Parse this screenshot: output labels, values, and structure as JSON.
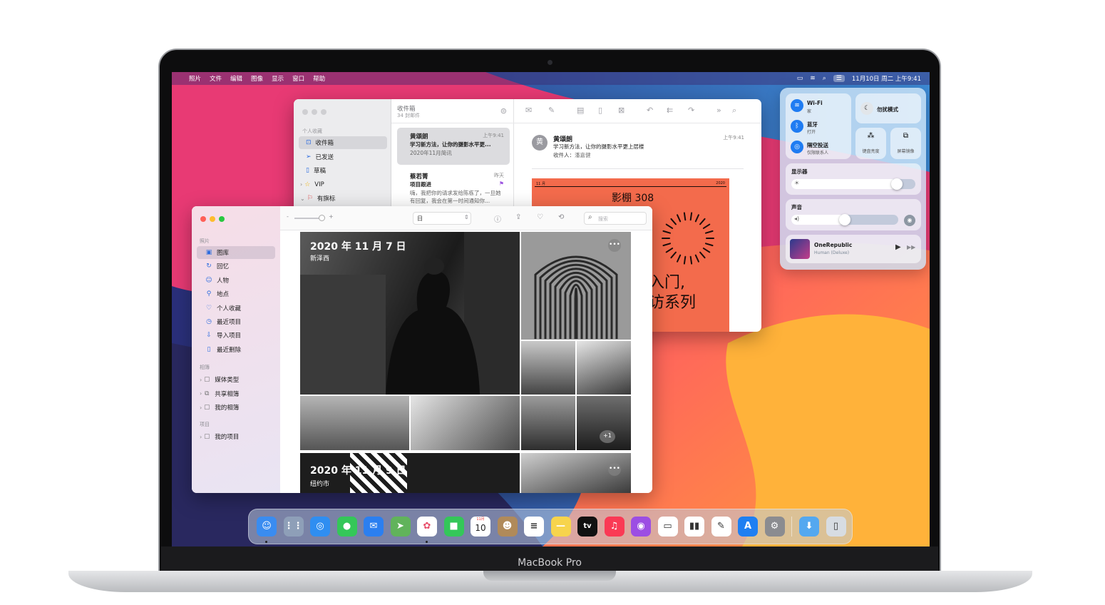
{
  "device": {
    "label": "MacBook Pro"
  },
  "menubar": {
    "apple": "",
    "items": [
      "照片",
      "文件",
      "编辑",
      "图像",
      "显示",
      "窗口",
      "帮助"
    ],
    "clock": "11月10日 周二 上午9:41"
  },
  "mail": {
    "sidebar": {
      "section": "个人收藏",
      "items": [
        {
          "label": "收件箱",
          "icon": "inbox-icon"
        },
        {
          "label": "已发送",
          "icon": "paperplane-icon"
        },
        {
          "label": "草稿",
          "icon": "document-icon"
        },
        {
          "label": "VIP",
          "icon": "star-icon"
        },
        {
          "label": "有旗标",
          "icon": "flag-icon"
        }
      ]
    },
    "list": {
      "title": "收件箱",
      "count": "34 封邮件",
      "messages": [
        {
          "sender": "黄頌朗",
          "time": "上午9:41",
          "subject": "学习新方法，让你的摄影水平更...",
          "preview": "2020年11月简讯"
        },
        {
          "sender": "蔡若菁",
          "time": "昨天",
          "subject": "项目跟进",
          "preview": "嗨，我把你的请求发给陈栋了，一旦她有回复，我会在第一时间通知你..."
        }
      ]
    },
    "reader": {
      "avatar": "黄",
      "sender": "黄頌朗",
      "time": "上午9:41",
      "subject": "学习新方法，让你的摄影水平更上层楼",
      "to_label": "收件人：",
      "to": "潘嘉健",
      "poster_title": "影棚 308",
      "poster_line1": "入门,",
      "poster_line2": "访系列",
      "poster_top_left": "11 月",
      "poster_top_right": "2020"
    }
  },
  "photos": {
    "sidebar": {
      "section_photos": "照片",
      "items": [
        {
          "label": "图库",
          "icon": "library-icon"
        },
        {
          "label": "回忆",
          "icon": "memories-icon"
        },
        {
          "label": "人物",
          "icon": "people-icon"
        },
        {
          "label": "地点",
          "icon": "places-icon"
        },
        {
          "label": "个人收藏",
          "icon": "heart-icon"
        },
        {
          "label": "最近项目",
          "icon": "clock-icon"
        },
        {
          "label": "导入项目",
          "icon": "import-icon"
        },
        {
          "label": "最近删除",
          "icon": "trash-icon"
        }
      ],
      "section_albums": "相簿",
      "albums": [
        {
          "label": "媒体类型",
          "icon": "folder-icon"
        },
        {
          "label": "共享相簿",
          "icon": "shared-album-icon"
        },
        {
          "label": "我的相簿",
          "icon": "folder-icon"
        }
      ],
      "section_projects": "项目",
      "projects": [
        {
          "label": "我的项目",
          "icon": "folder-icon"
        }
      ]
    },
    "toolbar": {
      "zoom_minus": "-",
      "zoom_plus": "+",
      "view": "日",
      "search_placeholder": "搜索"
    },
    "groups": [
      {
        "date": "2020 年 11 月 7 日",
        "place": "新泽西",
        "extra": "+1"
      },
      {
        "date": "2020 年 11 月 9 日",
        "place": "纽约市"
      }
    ]
  },
  "control_center": {
    "wifi": {
      "title": "Wi-Fi",
      "sub": "家"
    },
    "bluetooth": {
      "title": "蓝牙",
      "sub": "打开"
    },
    "airdrop": {
      "title": "隔空投送",
      "sub": "仅限联系人"
    },
    "dnd": {
      "title": "勿扰模式"
    },
    "keyboard": {
      "title": "键盘亮度"
    },
    "mirror": {
      "title": "屏幕镜像"
    },
    "display": {
      "title": "显示器",
      "level": 0.85
    },
    "sound": {
      "title": "声音",
      "level": 0.5
    },
    "now_playing": {
      "artist": "OneRepublic",
      "album": "Human (Deluxe)"
    }
  },
  "dock": {
    "apps": [
      {
        "name": "finder",
        "bg": "#3a8cf0",
        "glyph": "☺"
      },
      {
        "name": "launchpad",
        "bg": "#8e9fb8",
        "glyph": "⋮⋮"
      },
      {
        "name": "safari",
        "bg": "#2f8ef1",
        "glyph": "◎"
      },
      {
        "name": "messages",
        "bg": "#34c759",
        "glyph": "●"
      },
      {
        "name": "mail",
        "bg": "#2b7ff0",
        "glyph": "✉"
      },
      {
        "name": "maps",
        "bg": "#61b35b",
        "glyph": "➤"
      },
      {
        "name": "photos",
        "bg": "#ffffff",
        "glyph": "✿"
      },
      {
        "name": "facetime",
        "bg": "#34c759",
        "glyph": "■"
      },
      {
        "name": "calendar",
        "bg": "#ffffff",
        "glyph": "10",
        "sub": "11月"
      },
      {
        "name": "contacts",
        "bg": "#b08a5a",
        "glyph": "☻"
      },
      {
        "name": "reminders",
        "bg": "#ffffff",
        "glyph": "≡"
      },
      {
        "name": "notes",
        "bg": "#f7d44c",
        "glyph": "—"
      },
      {
        "name": "tv",
        "bg": "#111111",
        "glyph": "tv"
      },
      {
        "name": "music",
        "bg": "#fa3a55",
        "glyph": "♫"
      },
      {
        "name": "podcasts",
        "bg": "#9c4ee3",
        "glyph": "◉"
      },
      {
        "name": "keynote",
        "bg": "#ffffff",
        "glyph": "▭"
      },
      {
        "name": "numbers",
        "bg": "#ffffff",
        "glyph": "▮▮"
      },
      {
        "name": "pages",
        "bg": "#ffffff",
        "glyph": "✎"
      },
      {
        "name": "app-store",
        "bg": "#1e7ff2",
        "glyph": "A"
      },
      {
        "name": "system-preferences",
        "bg": "#8b8c90",
        "glyph": "⚙"
      },
      {
        "name": "downloads",
        "bg": "#54a8f0",
        "glyph": "⬇"
      },
      {
        "name": "trash",
        "bg": "#d7dce2",
        "glyph": "▯"
      }
    ],
    "running": [
      0,
      6
    ]
  }
}
